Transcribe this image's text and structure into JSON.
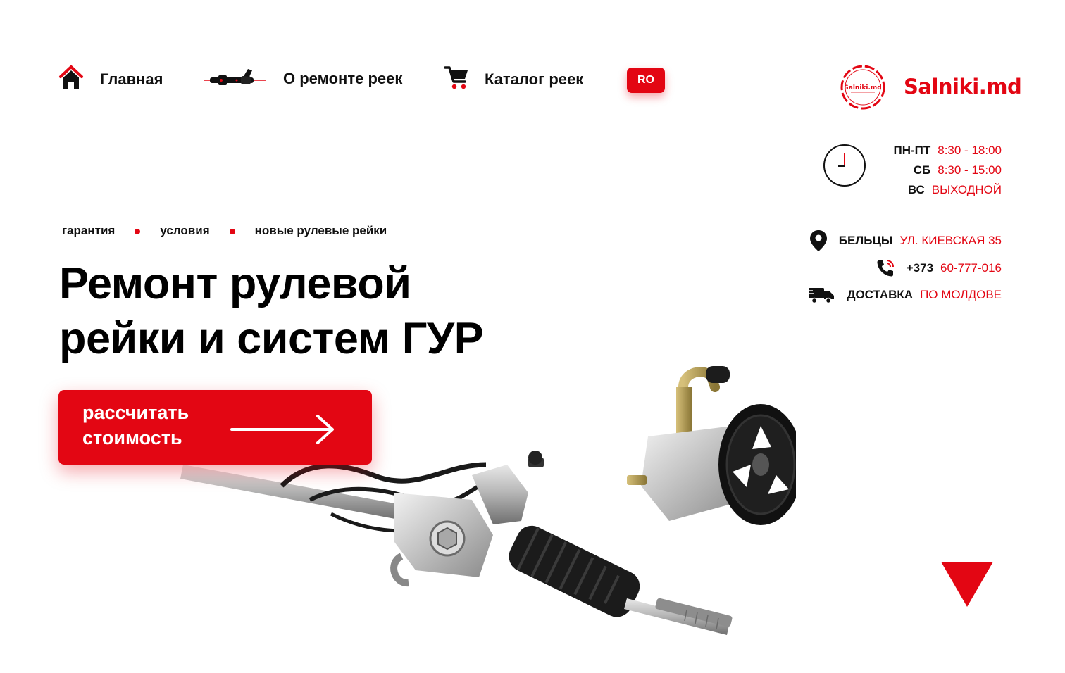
{
  "nav": {
    "home": "Главная",
    "repair": "О ремонте реек",
    "catalog": "Каталог реек",
    "lang": "RO"
  },
  "logo": {
    "text": "Salniki.md",
    "badge_text": "Salniki.md"
  },
  "hours": [
    {
      "day": "ПН-ПТ",
      "time": "8:30 - 18:00"
    },
    {
      "day": "СБ",
      "time": "8:30 - 15:00"
    },
    {
      "day": "ВС",
      "time": "ВЫХОДНОЙ"
    }
  ],
  "contacts": {
    "city": "БЕЛЬЦЫ",
    "address": "УЛ. КИЕВСКАЯ 35",
    "phone_code": "+373",
    "phone_number": "60-777-016",
    "delivery_label": "ДОСТАВКА",
    "delivery_area": "ПО МОЛДОВЕ"
  },
  "tags": [
    "гарантия",
    "условия",
    "новые рулевые рейки"
  ],
  "hero": {
    "title_line1": "Ремонт рулевой",
    "title_line2": "рейки и систем ГУР"
  },
  "cta": {
    "line1": "рассчитать",
    "line2": "стоимость"
  },
  "colors": {
    "accent": "#e30613",
    "text": "#111111",
    "background": "#ffffff"
  },
  "icons": [
    "home-icon",
    "steering-rack-icon",
    "cart-icon",
    "clock-icon",
    "location-pin-icon",
    "phone-icon",
    "delivery-truck-icon",
    "arrow-right-icon",
    "triangle-down-icon"
  ]
}
